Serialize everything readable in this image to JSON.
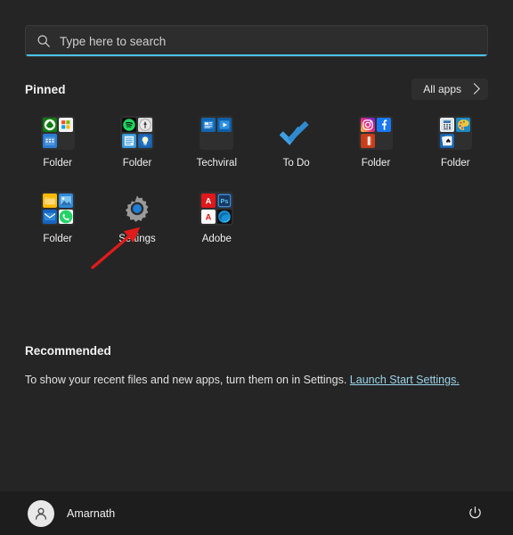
{
  "search": {
    "placeholder": "Type here to search",
    "value": "",
    "icon": "search-icon",
    "accent_color": "#4cc2f1"
  },
  "pinned": {
    "title": "Pinned",
    "all_apps_label": "All apps",
    "all_apps_chevron": "chevron-right-icon",
    "tiles": [
      {
        "label": "Folder",
        "type": "folder",
        "apps": [
          "xbox",
          "microsoft-store",
          "calendar",
          "empty"
        ]
      },
      {
        "label": "Folder",
        "type": "folder",
        "apps": [
          "spotify",
          "clock",
          "sticky-notes",
          "tips"
        ]
      },
      {
        "label": "Techviral",
        "type": "folder",
        "apps": [
          "news",
          "media-player",
          "empty",
          "empty"
        ]
      },
      {
        "label": "To Do",
        "type": "app",
        "apps": [
          "microsoft-to-do"
        ]
      },
      {
        "label": "Folder",
        "type": "folder",
        "apps": [
          "instagram",
          "facebook",
          "office",
          "empty"
        ]
      },
      {
        "label": "Folder",
        "type": "folder",
        "apps": [
          "calculator",
          "paint",
          "solitaire",
          "empty"
        ]
      },
      {
        "label": "Folder",
        "type": "folder",
        "apps": [
          "file-explorer",
          "photos",
          "mail",
          "whatsapp"
        ]
      },
      {
        "label": "Settings",
        "type": "app",
        "apps": [
          "settings-gear"
        ]
      },
      {
        "label": "Adobe",
        "type": "folder",
        "apps": [
          "adobe-acrobat",
          "photoshop",
          "adobe-indesign",
          "microsoft-edge"
        ]
      }
    ]
  },
  "recommended": {
    "title": "Recommended",
    "message": "To show your recent files and new apps, turn them on in Settings.",
    "link_label": "Launch Start Settings.",
    "link_color": "#9ad4e8"
  },
  "bottom": {
    "user_name": "Amarnath",
    "avatar_icon": "user-avatar-icon",
    "power_icon": "power-icon"
  },
  "annotation": {
    "arrow_color": "#e01b1b",
    "points_to": "Settings"
  }
}
